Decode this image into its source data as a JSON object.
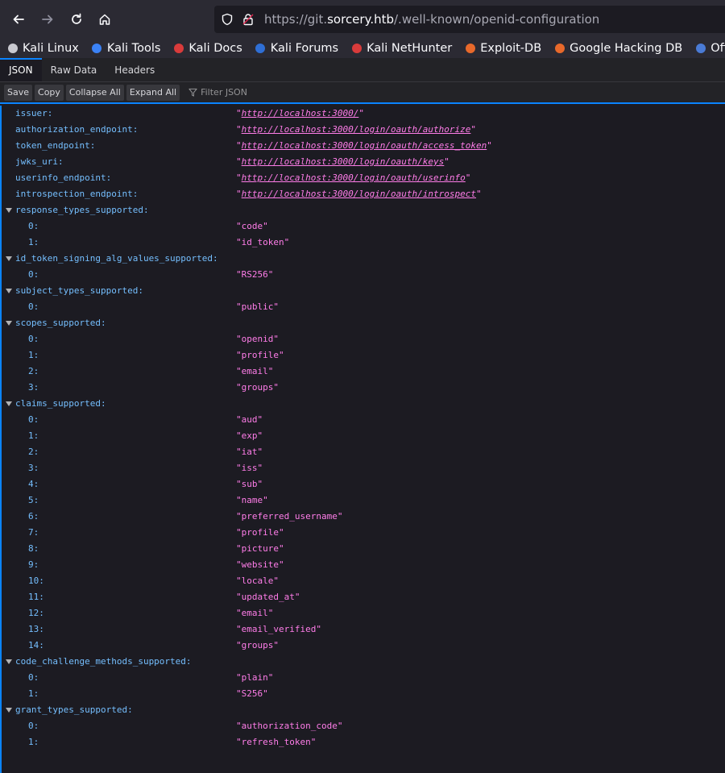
{
  "urlbar": {
    "url_scheme": "https://git.",
    "url_domain": "sorcery.htb",
    "url_path": "/.well-known/openid-configuration"
  },
  "bookmarks": [
    {
      "label": "Kali Linux",
      "icon": "kali-dragon-icon",
      "color": "#c9c9d0"
    },
    {
      "label": "Kali Tools",
      "icon": "kali-tools-icon",
      "color": "#3b82f6"
    },
    {
      "label": "Kali Docs",
      "icon": "kali-docs-icon",
      "color": "#d93b3b"
    },
    {
      "label": "Kali Forums",
      "icon": "kali-forums-icon",
      "color": "#2f6fd6"
    },
    {
      "label": "Kali NetHunter",
      "icon": "nethunter-icon",
      "color": "#d93b3b"
    },
    {
      "label": "Exploit-DB",
      "icon": "exploit-db-icon",
      "color": "#e8692b"
    },
    {
      "label": "Google Hacking DB",
      "icon": "ghdb-icon",
      "color": "#e8692b"
    },
    {
      "label": "OffSec",
      "icon": "offsec-icon",
      "color": "#4a7bd6"
    }
  ],
  "tabs": [
    "JSON",
    "Raw Data",
    "Headers"
  ],
  "toolbar": {
    "save": "Save",
    "copy": "Copy",
    "collapse": "Collapse All",
    "expand": "Expand All",
    "filter_placeholder": "Filter JSON"
  },
  "rows": [
    {
      "key": "issuer:",
      "value": "http://localhost:3000/",
      "link": true
    },
    {
      "key": "authorization_endpoint:",
      "value": "http://localhost:3000/login/oauth/authorize",
      "link": true
    },
    {
      "key": "token_endpoint:",
      "value": "http://localhost:3000/login/oauth/access_token",
      "link": true
    },
    {
      "key": "jwks_uri:",
      "value": "http://localhost:3000/login/oauth/keys",
      "link": true
    },
    {
      "key": "userinfo_endpoint:",
      "value": "http://localhost:3000/login/oauth/userinfo",
      "link": true
    },
    {
      "key": "introspection_endpoint:",
      "value": "http://localhost:3000/login/oauth/introspect",
      "link": true
    },
    {
      "key": "response_types_supported:",
      "group": true
    },
    {
      "key": "0:",
      "value": "code",
      "child": true
    },
    {
      "key": "1:",
      "value": "id_token",
      "child": true
    },
    {
      "key": "id_token_signing_alg_values_supported:",
      "group": true
    },
    {
      "key": "0:",
      "value": "RS256",
      "child": true
    },
    {
      "key": "subject_types_supported:",
      "group": true
    },
    {
      "key": "0:",
      "value": "public",
      "child": true
    },
    {
      "key": "scopes_supported:",
      "group": true
    },
    {
      "key": "0:",
      "value": "openid",
      "child": true
    },
    {
      "key": "1:",
      "value": "profile",
      "child": true
    },
    {
      "key": "2:",
      "value": "email",
      "child": true
    },
    {
      "key": "3:",
      "value": "groups",
      "child": true
    },
    {
      "key": "claims_supported:",
      "group": true
    },
    {
      "key": "0:",
      "value": "aud",
      "child": true
    },
    {
      "key": "1:",
      "value": "exp",
      "child": true
    },
    {
      "key": "2:",
      "value": "iat",
      "child": true
    },
    {
      "key": "3:",
      "value": "iss",
      "child": true
    },
    {
      "key": "4:",
      "value": "sub",
      "child": true
    },
    {
      "key": "5:",
      "value": "name",
      "child": true
    },
    {
      "key": "6:",
      "value": "preferred_username",
      "child": true
    },
    {
      "key": "7:",
      "value": "profile",
      "child": true
    },
    {
      "key": "8:",
      "value": "picture",
      "child": true
    },
    {
      "key": "9:",
      "value": "website",
      "child": true
    },
    {
      "key": "10:",
      "value": "locale",
      "child": true
    },
    {
      "key": "11:",
      "value": "updated_at",
      "child": true
    },
    {
      "key": "12:",
      "value": "email",
      "child": true
    },
    {
      "key": "13:",
      "value": "email_verified",
      "child": true
    },
    {
      "key": "14:",
      "value": "groups",
      "child": true
    },
    {
      "key": "code_challenge_methods_supported:",
      "group": true
    },
    {
      "key": "0:",
      "value": "plain",
      "child": true
    },
    {
      "key": "1:",
      "value": "S256",
      "child": true
    },
    {
      "key": "grant_types_supported:",
      "group": true
    },
    {
      "key": "0:",
      "value": "authorization_code",
      "child": true
    },
    {
      "key": "1:",
      "value": "refresh_token",
      "child": true
    }
  ]
}
